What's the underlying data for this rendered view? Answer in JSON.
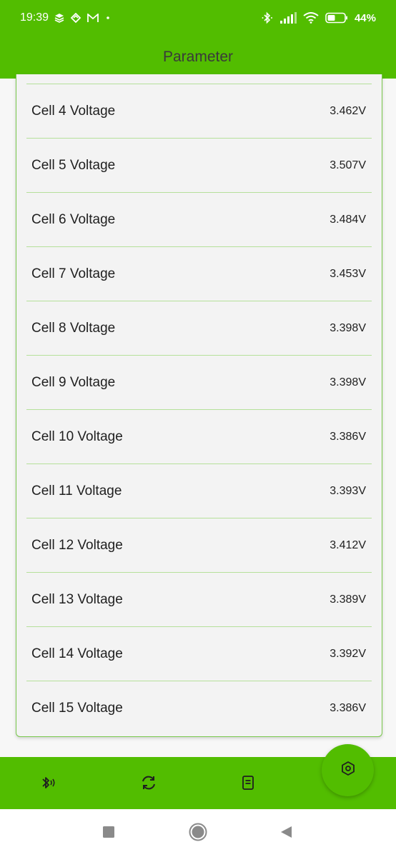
{
  "status_bar": {
    "time": "19:39",
    "battery_text": "44%",
    "icons_left": [
      "layers-icon",
      "mobile-data-icon",
      "gmail-icon",
      "notification-dot-icon"
    ],
    "icons_right": [
      "bluetooth-icon",
      "signal-icon",
      "wifi-icon",
      "battery-icon"
    ]
  },
  "header": {
    "title": "Parameter"
  },
  "rows": [
    {
      "label": "Cell 4 Voltage",
      "value": "3.462V"
    },
    {
      "label": "Cell 5 Voltage",
      "value": "3.507V"
    },
    {
      "label": "Cell 6 Voltage",
      "value": "3.484V"
    },
    {
      "label": "Cell 7 Voltage",
      "value": "3.453V"
    },
    {
      "label": "Cell 8 Voltage",
      "value": "3.398V"
    },
    {
      "label": "Cell 9 Voltage",
      "value": "3.398V"
    },
    {
      "label": "Cell 10 Voltage",
      "value": "3.386V"
    },
    {
      "label": "Cell 11 Voltage",
      "value": "3.393V"
    },
    {
      "label": "Cell 12 Voltage",
      "value": "3.412V"
    },
    {
      "label": "Cell 13 Voltage",
      "value": "3.389V"
    },
    {
      "label": "Cell 14 Voltage",
      "value": "3.392V"
    },
    {
      "label": "Cell 15 Voltage",
      "value": "3.386V"
    }
  ],
  "bottom_nav": {
    "items": [
      "bluetooth-scan-icon",
      "refresh-icon",
      "document-icon"
    ],
    "fab": "settings-hexagon-icon"
  },
  "system_nav": [
    "recents-icon",
    "home-icon",
    "back-icon"
  ],
  "colors": {
    "primary": "#52bd00",
    "divider": "#b5e09a",
    "card_background": "#f3f3f3",
    "text": "#1f1f1f",
    "header_text": "#3a3a3a"
  }
}
